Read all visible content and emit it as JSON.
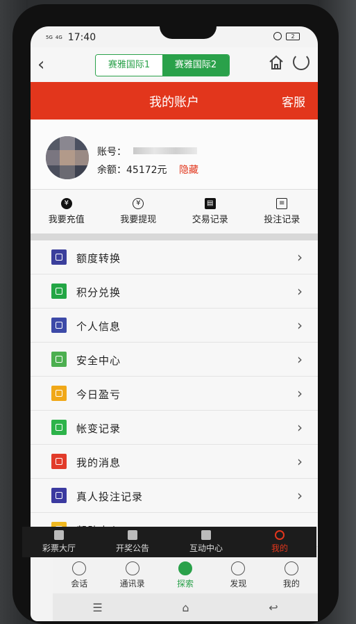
{
  "status": {
    "time": "17:40",
    "signal1": "5G",
    "signal2": "4G",
    "battery": "2"
  },
  "nav": {
    "back_icon": "chevron-left-icon",
    "tabs": [
      {
        "label": "赛雅国际1",
        "active": false
      },
      {
        "label": "赛雅国际2",
        "active": true
      }
    ]
  },
  "header": {
    "title": "我的账户",
    "service": "客服"
  },
  "account": {
    "account_label": "账号：",
    "balance_label": "余额：",
    "balance": "45172元",
    "hide": "隐藏"
  },
  "quick": [
    {
      "label": "我要充值",
      "glyph": "¥"
    },
    {
      "label": "我要提现",
      "glyph": "¥"
    },
    {
      "label": "交易记录",
      "glyph": "▤"
    },
    {
      "label": "投注记录",
      "glyph": "≡"
    }
  ],
  "menu": [
    {
      "label": "额度转换",
      "color": "#3b3f9c"
    },
    {
      "label": "积分兑换",
      "color": "#23a645"
    },
    {
      "label": "个人信息",
      "color": "#3d4aa8"
    },
    {
      "label": "安全中心",
      "color": "#4caf50"
    },
    {
      "label": "今日盈亏",
      "color": "#f0a818"
    },
    {
      "label": "帐变记录",
      "color": "#2db34a"
    },
    {
      "label": "我的消息",
      "color": "#e23b2a"
    },
    {
      "label": "真人投注记录",
      "color": "#3b3aa0"
    },
    {
      "label": "帮助中心",
      "color": "#f0b820"
    }
  ],
  "bottom_tabs": [
    {
      "label": "彩票大厅"
    },
    {
      "label": "开奖公告"
    },
    {
      "label": "互动中心"
    },
    {
      "label": "我的"
    }
  ],
  "wechat_tabs": [
    {
      "label": "会话"
    },
    {
      "label": "通讯录"
    },
    {
      "label": "探索"
    },
    {
      "label": "发现"
    },
    {
      "label": "我的"
    }
  ]
}
